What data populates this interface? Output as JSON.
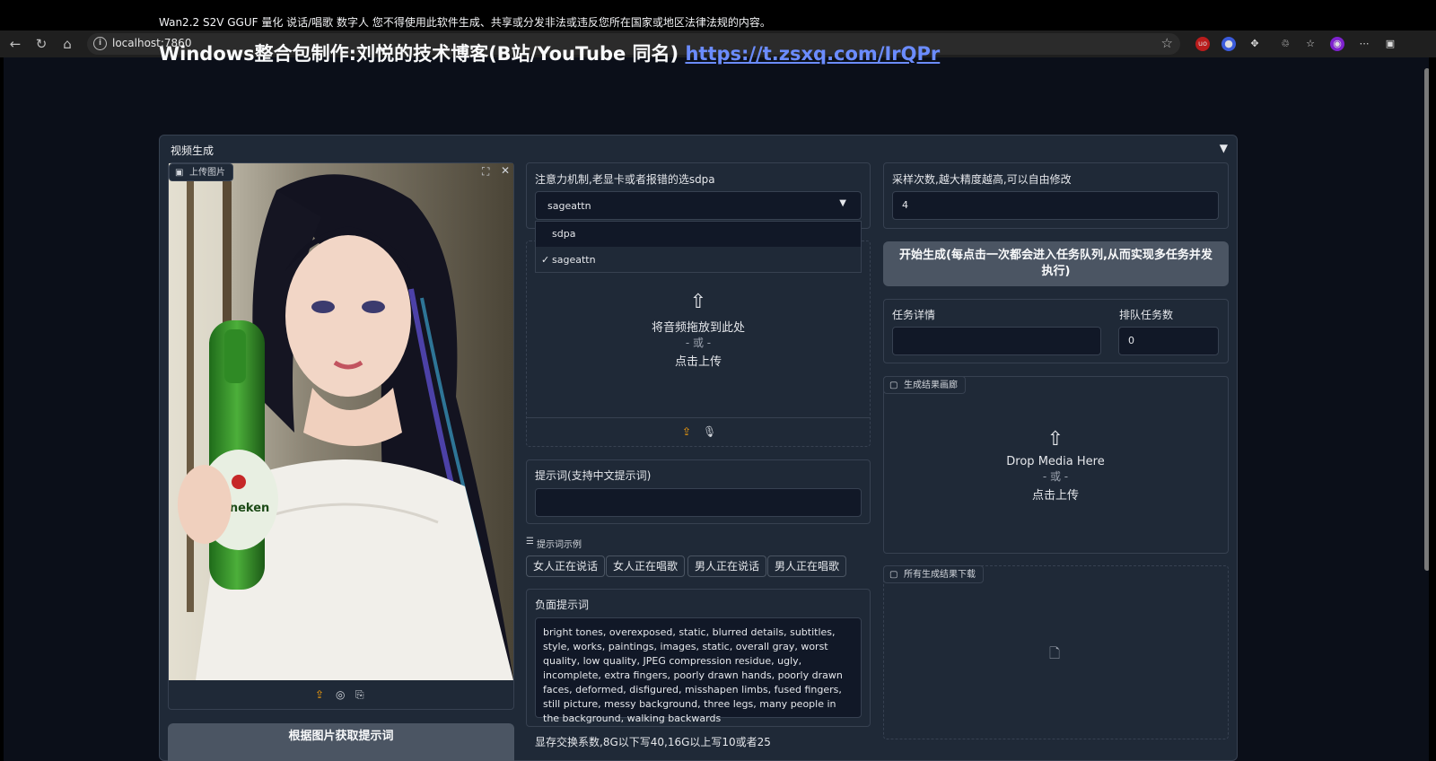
{
  "browser": {
    "url": "localhost:7860"
  },
  "page": {
    "notice": "Wan2.2 S2V GGUF 量化 说话/唱歌 数字人 您不得使用此软件生成、共享或分发非法或违反您所在国家或地区法律法规的内容。",
    "title_prefix": "Windows整合包制作:刘悦的技术博客(B站/YouTube 同名) ",
    "title_link": "https://t.zsxq.com/IrQPr"
  },
  "accordion": {
    "title": "视频生成",
    "arrow": "▼"
  },
  "image_upload": {
    "label": "上传图片",
    "image_alt": "woman holding Heineken bottle"
  },
  "attention": {
    "label": "注意力机制,老显卡或者报错的选sdpa",
    "selected": "sageattn",
    "options": [
      "sdpa",
      "sageattn"
    ],
    "checkmark": "✓"
  },
  "audio_upload": {
    "drop_text": "将音频拖放到此处",
    "or_text": "- 或 -",
    "click_text": "点击上传"
  },
  "prompt": {
    "label": "提示词(支持中文提示词)",
    "value": ""
  },
  "examples": {
    "label": "提示词示例",
    "items": [
      "女人正在说话",
      "女人正在唱歌",
      "男人正在说话",
      "男人正在唱歌"
    ]
  },
  "negative": {
    "label": "负面提示词",
    "value": "bright tones, overexposed, static, blurred details, subtitles, style, works, paintings, images, static, overall gray, worst quality, low quality, JPEG compression residue, ugly, incomplete, extra fingers, poorly drawn hands, poorly drawn faces, deformed, disfigured, misshapen limbs, fused fingers, still picture, messy background, three legs, many people in the background, walking backwards"
  },
  "swap": {
    "label": "显存交换系数,8G以下写40,16G以上写10或者25"
  },
  "get_prompt_button": "根据图片获取提示词",
  "steps": {
    "label": "采样次数,越大精度越高,可以自由修改",
    "value": "4"
  },
  "generate_button": "开始生成(每点击一次都会进入任务队列,从而实现多任务并发执行)",
  "task": {
    "detail_label": "任务详情",
    "queue_label": "排队任务数",
    "queue_value": "0"
  },
  "gallery": {
    "label": "生成结果画廊",
    "drop_text": "Drop Media Here",
    "or_text": "- 或 -",
    "click_text": "点击上传"
  },
  "downloads": {
    "label": "所有生成结果下载"
  }
}
